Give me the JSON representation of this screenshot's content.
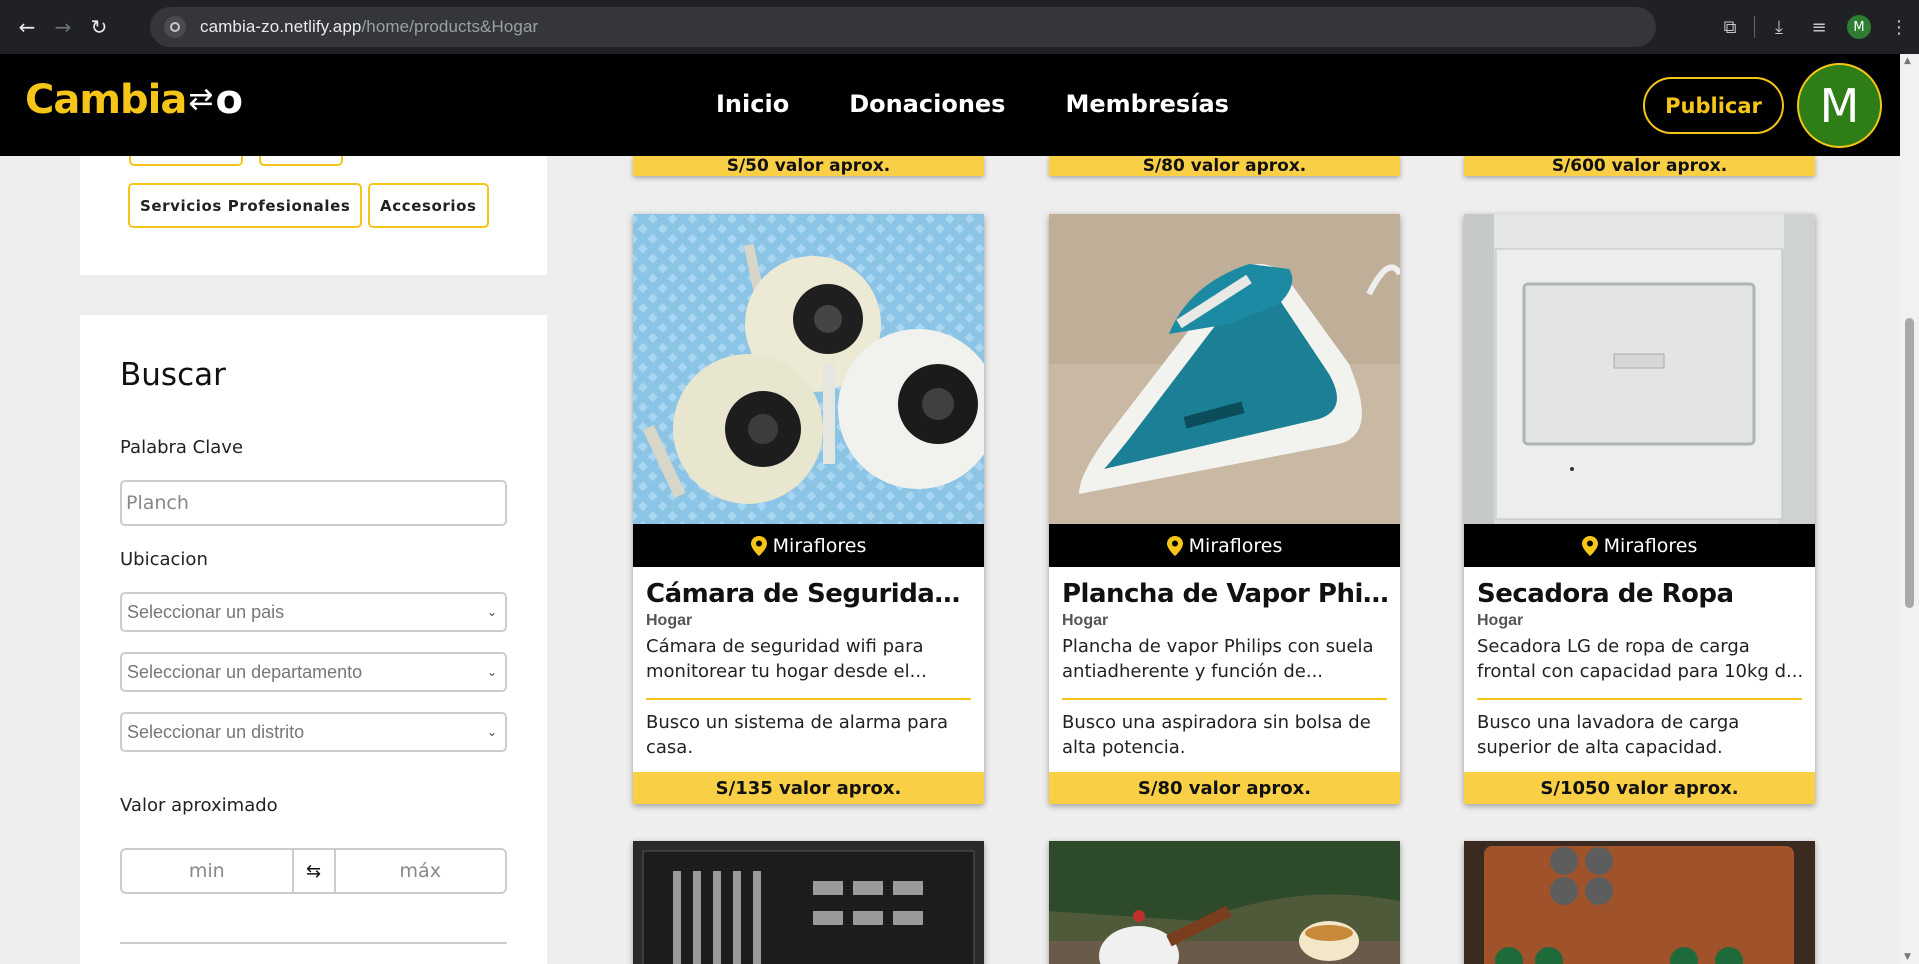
{
  "browser": {
    "url_host": "cambia-zo.netlify.app",
    "url_path": "/home/products&Hogar",
    "profile_initial": "M"
  },
  "header": {
    "logo_text": "Cambia",
    "logo_end": "o",
    "nav": [
      "Inicio",
      "Donaciones",
      "Membresías"
    ],
    "publish_label": "Publicar",
    "avatar_initial": "M"
  },
  "categories": {
    "chips": [
      "Servicios Profesionales",
      "Accesorios"
    ]
  },
  "search": {
    "title": "Buscar",
    "keyword_label": "Palabra Clave",
    "keyword_value": "Planch",
    "location_label": "Ubicacion",
    "country_placeholder": "Seleccionar un pais",
    "department_placeholder": "Seleccionar un departamento",
    "district_placeholder": "Seleccionar un distrito",
    "value_label": "Valor aproximado",
    "min_placeholder": "min",
    "max_placeholder": "máx"
  },
  "previous_row_prices": [
    "S/50 valor aprox.",
    "S/80 valor aprox.",
    "S/600 valor aprox."
  ],
  "products": [
    {
      "location": "Miraflores",
      "title": "Cámara de Seguridad...",
      "category": "Hogar",
      "description": "Cámara de seguridad wifi para monitorear tu hogar desde el...",
      "wants": "Busco un sistema de alarma para casa.",
      "price": "S/135 valor aprox."
    },
    {
      "location": "Miraflores",
      "title": "Plancha de Vapor Philips",
      "category": "Hogar",
      "description": "Plancha de vapor Philips con suela antiadherente y función de...",
      "wants": "Busco una aspiradora sin bolsa de alta potencia.",
      "price": "S/80 valor aprox."
    },
    {
      "location": "Miraflores",
      "title": "Secadora de Ropa",
      "category": "Hogar",
      "description": "Secadora LG de ropa de carga frontal con capacidad para 10kg d...",
      "wants": "Busco una lavadora de carga superior de alta capacidad.",
      "price": "S/1050 valor aprox."
    }
  ],
  "colors": {
    "accent": "#f5c518",
    "price_bar": "#f9cf45",
    "header_bg": "#000000"
  }
}
